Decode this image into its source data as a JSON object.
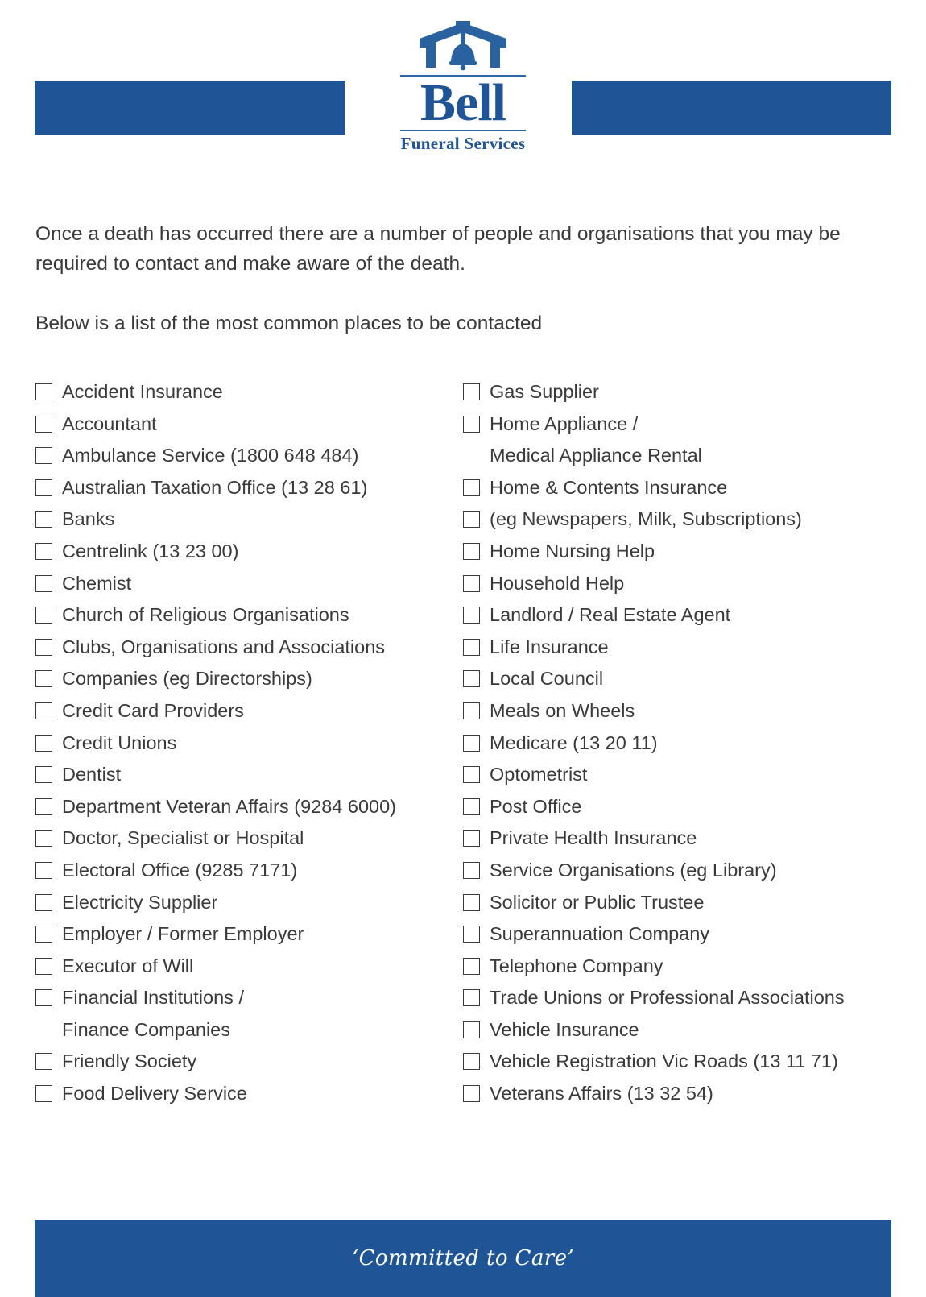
{
  "brand": {
    "name": "Bell",
    "tagline_sub": "Funeral Services",
    "logo_icon": "bell-arch-icon",
    "accent_color": "#1f5596"
  },
  "intro": {
    "paragraph_1": "Once a death has occurred there are a number of people and organisations that you may be required to contact and make aware of the death.",
    "paragraph_2": "Below is a list of the most common places to be contacted"
  },
  "checklist": {
    "left_column": [
      {
        "label": "Accident Insurance",
        "checkbox": true
      },
      {
        "label": "Accountant",
        "checkbox": true
      },
      {
        "label": "Ambulance Service (1800 648 484)",
        "checkbox": true
      },
      {
        "label": "Australian Taxation Office (13 28 61)",
        "checkbox": true
      },
      {
        "label": "Banks",
        "checkbox": true
      },
      {
        "label": "Centrelink (13 23 00)",
        "checkbox": true
      },
      {
        "label": "Chemist",
        "checkbox": true
      },
      {
        "label": "Church of Religious Organisations",
        "checkbox": true
      },
      {
        "label": "Clubs, Organisations and Associations",
        "checkbox": true
      },
      {
        "label": "Companies (eg Directorships)",
        "checkbox": true
      },
      {
        "label": "Credit Card Providers",
        "checkbox": true
      },
      {
        "label": "Credit Unions",
        "checkbox": true
      },
      {
        "label": "Dentist",
        "checkbox": true
      },
      {
        "label": "Department Veteran Affairs (9284 6000)",
        "checkbox": true
      },
      {
        "label": "Doctor, Specialist or Hospital",
        "checkbox": true
      },
      {
        "label": "Electoral Office (9285 7171)",
        "checkbox": true
      },
      {
        "label": "Electricity Supplier",
        "checkbox": true
      },
      {
        "label": "Employer / Former Employer",
        "checkbox": true
      },
      {
        "label": "Executor of Will",
        "checkbox": true
      },
      {
        "label": "Financial Institutions /",
        "checkbox": true
      },
      {
        "label": "Finance Companies",
        "checkbox": false
      },
      {
        "label": "Friendly Society",
        "checkbox": true
      },
      {
        "label": "Food Delivery Service",
        "checkbox": true
      }
    ],
    "right_column": [
      {
        "label": "Gas Supplier",
        "checkbox": true
      },
      {
        "label": "Home Appliance /",
        "checkbox": true
      },
      {
        "label": "Medical Appliance Rental",
        "checkbox": false
      },
      {
        "label": "Home & Contents Insurance",
        "checkbox": true
      },
      {
        "label": "(eg Newspapers, Milk, Subscriptions)",
        "checkbox": true
      },
      {
        "label": "Home Nursing Help",
        "checkbox": true
      },
      {
        "label": "Household Help",
        "checkbox": true
      },
      {
        "label": "Landlord / Real Estate Agent",
        "checkbox": true
      },
      {
        "label": "Life Insurance",
        "checkbox": true
      },
      {
        "label": "Local Council",
        "checkbox": true
      },
      {
        "label": "Meals on Wheels",
        "checkbox": true
      },
      {
        "label": "Medicare (13 20 11)",
        "checkbox": true
      },
      {
        "label": "Optometrist",
        "checkbox": true
      },
      {
        "label": "Post Office",
        "checkbox": true
      },
      {
        "label": "Private Health Insurance",
        "checkbox": true
      },
      {
        "label": "Service Organisations (eg Library)",
        "checkbox": true
      },
      {
        "label": "Solicitor or Public Trustee",
        "checkbox": true
      },
      {
        "label": "Superannuation Company",
        "checkbox": true
      },
      {
        "label": "Telephone Company",
        "checkbox": true
      },
      {
        "label": "Trade Unions or Professional Associations",
        "checkbox": true
      },
      {
        "label": "Vehicle Insurance",
        "checkbox": true
      },
      {
        "label": "Vehicle Registration Vic Roads (13 11 71)",
        "checkbox": true
      },
      {
        "label": "Veterans Affairs (13 32 54)",
        "checkbox": true
      }
    ]
  },
  "footer": {
    "tagline": "‘Committed to Care’"
  }
}
